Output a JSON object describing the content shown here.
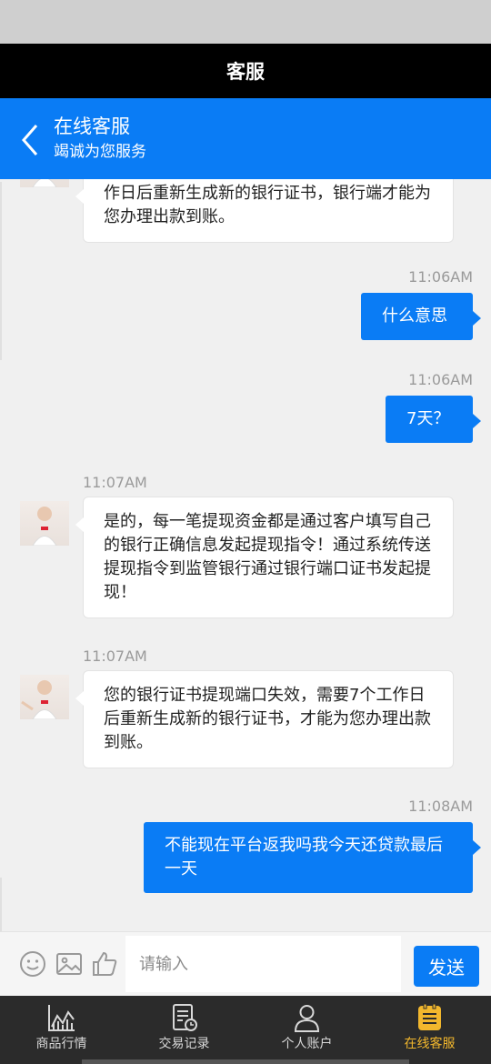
{
  "header": {
    "title": "客服"
  },
  "chat_header": {
    "title": "在线客服",
    "subtitle": "竭诚为您服务"
  },
  "messages": [
    {
      "from": "agent",
      "text": "作日后重新生成新的银行证书，银行端才能为您办理出款到账。"
    },
    {
      "from": "user",
      "time": "11:06AM",
      "text": "什么意思"
    },
    {
      "from": "user",
      "time": "11:06AM",
      "text": "7天？"
    },
    {
      "from": "agent",
      "time": "11:07AM",
      "text": "是的，每一笔提现资金都是通过客户填写自己的银行正确信息发起提现指令！通过系统传送提现指令到监管银行通过银行端口证书发起提现！"
    },
    {
      "from": "agent",
      "time": "11:07AM",
      "text": "您的银行证书提现端口失效，需要7个工作日后重新生成新的银行证书，才能为您办理出款到账。"
    },
    {
      "from": "user",
      "time": "11:08AM",
      "text": "不能现在平台返我吗我今天还贷款最后一天"
    }
  ],
  "input": {
    "placeholder": "请输入",
    "send_label": "发送"
  },
  "tabs": [
    {
      "label": "商品行情",
      "icon": "chart-icon",
      "active": false
    },
    {
      "label": "交易记录",
      "icon": "record-icon",
      "active": false
    },
    {
      "label": "个人账户",
      "icon": "person-icon",
      "active": false
    },
    {
      "label": "在线客服",
      "icon": "service-icon",
      "active": true
    }
  ],
  "colors": {
    "primary": "#0a7cf5",
    "active_tab": "#f2b72d",
    "tabbar": "#2b2b2b"
  }
}
